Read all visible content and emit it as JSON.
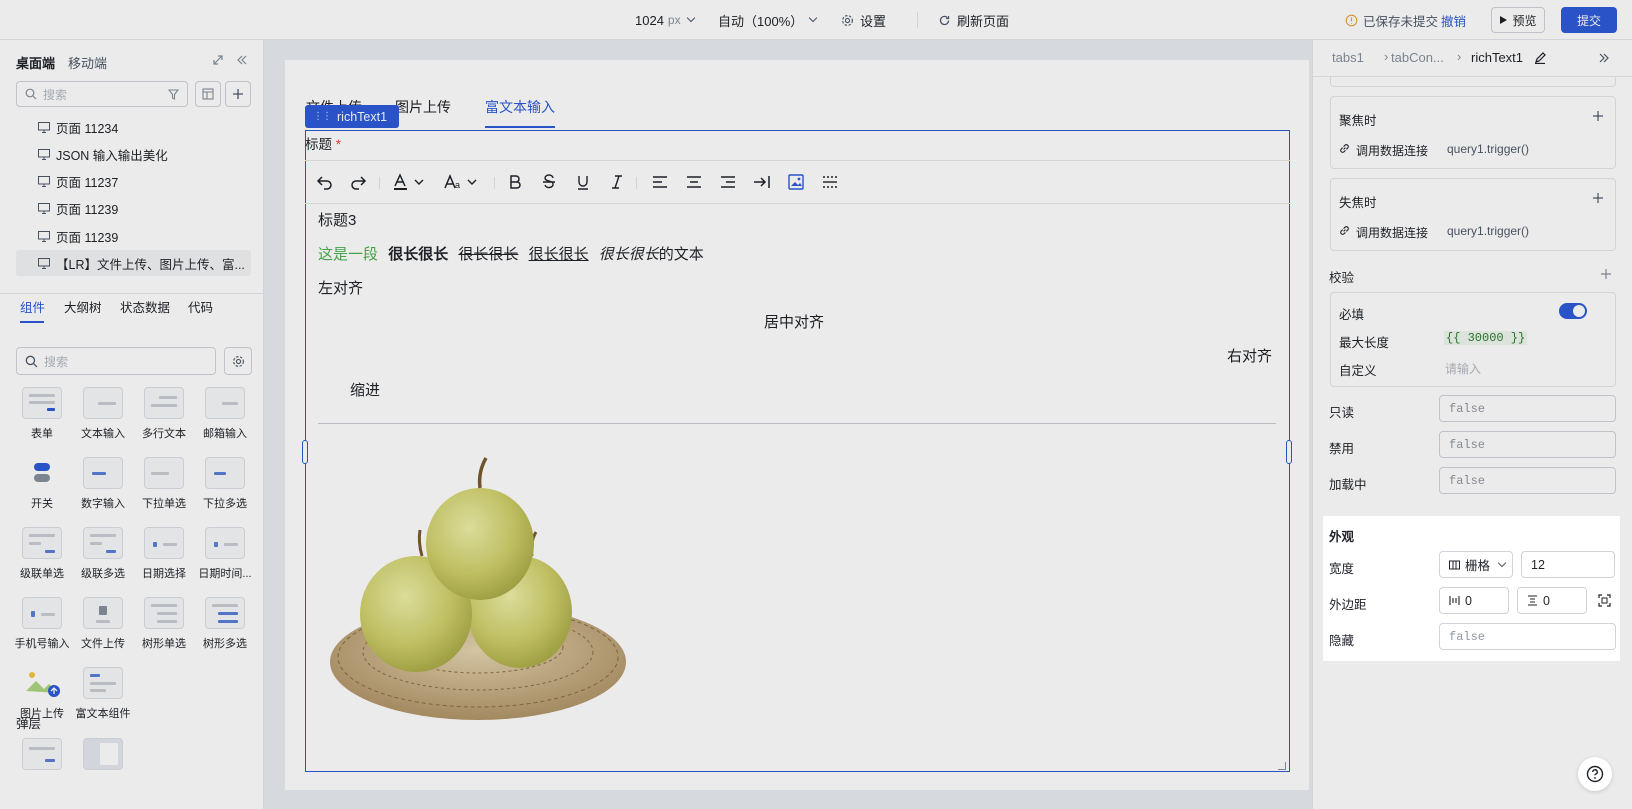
{
  "topbar": {
    "width_value": "1024",
    "width_unit": "px",
    "zoom": "自动（100%）",
    "settings": "设置",
    "refresh": "刷新页面",
    "save_status": "已保存未提交",
    "undo": "撤销",
    "preview": "预览",
    "submit": "提交"
  },
  "sidebar": {
    "tabs": [
      "桌面端",
      "移动端"
    ],
    "search_placeholder": "搜索",
    "pages": [
      "页面 11234",
      "JSON 输入输出美化",
      "页面 11237",
      "页面 11239",
      "页面 11239",
      "【LR】文件上传、图片上传、富..."
    ],
    "sub_tabs": [
      "组件",
      "大纲树",
      "状态数据",
      "代码"
    ],
    "component_search_placeholder": "搜索",
    "components": [
      "表单",
      "文本输入",
      "多行文本",
      "邮箱输入",
      "开关",
      "数字输入",
      "下拉单选",
      "下拉多选",
      "级联单选",
      "级联多选",
      "日期选择",
      "日期时间...",
      "手机号输入",
      "文件上传",
      "树形单选",
      "树形多选",
      "图片上传",
      "富文本组件"
    ],
    "section_popup": "弹层"
  },
  "canvas": {
    "tabs": [
      "文件上传",
      "图片上传",
      "富文本输入"
    ],
    "selected_component": "richText1",
    "field_label": "标题",
    "required_mark": "*",
    "content": {
      "heading": "标题3",
      "line_green": "这是一段",
      "line_bold": "很长很长",
      "line_strike": "很长很长",
      "line_underline": "很长很长",
      "line_italic": "很长很长",
      "line_tail": "的文本",
      "left": "左对齐",
      "center": "居中对齐",
      "right": "右对齐",
      "indent": "缩进"
    }
  },
  "panel": {
    "breadcrumb": [
      "tabs1",
      "tabCon...",
      "richText1"
    ],
    "focus": {
      "title": "聚焦时",
      "action": "调用数据连接",
      "value": "query1.trigger()"
    },
    "blur": {
      "title": "失焦时",
      "action": "调用数据连接",
      "value": "query1.trigger()"
    },
    "validation": {
      "title": "校验",
      "required": "必填",
      "required_on": true,
      "max_length_label": "最大长度",
      "max_length_value": "{{ 30000 }}",
      "custom_label": "自定义",
      "custom_placeholder": "请输入"
    },
    "readonly": {
      "label": "只读",
      "value": "false"
    },
    "disabled": {
      "label": "禁用",
      "value": "false"
    },
    "loading": {
      "label": "加载中",
      "value": "false"
    },
    "appearance": {
      "title": "外观",
      "width_label": "宽度",
      "width_mode": "栅格",
      "width_value": "12",
      "margin_label": "外边距",
      "margin_h": "0",
      "margin_v": "0",
      "hidden_label": "隐藏",
      "hidden_value": "false"
    }
  },
  "colors": {
    "primary": "#2d5bd7",
    "green_text": "#4caf50",
    "toggle_on": "#2d5bd7"
  }
}
